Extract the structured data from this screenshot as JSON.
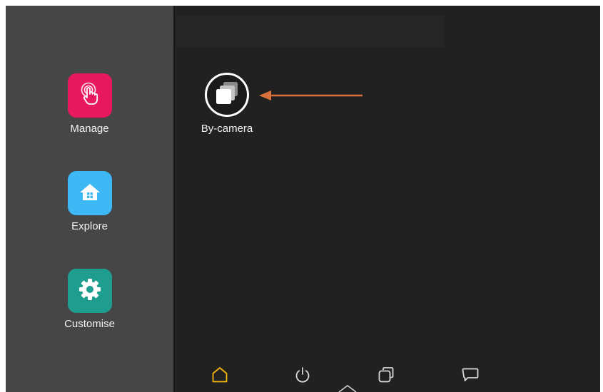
{
  "sidebar": {
    "apps": [
      {
        "label": "Manage",
        "icon": "touch-hand-icon",
        "color": "#e8185e"
      },
      {
        "label": "Explore",
        "icon": "house-icon",
        "color": "#3db8f5"
      },
      {
        "label": "Customise",
        "icon": "gear-icon",
        "color": "#1f9e8f"
      }
    ]
  },
  "home": {
    "apps": [
      {
        "label": "By-camera",
        "icon": "stacked-squares-icon"
      }
    ],
    "annotation_arrow_color": "#d9713d"
  },
  "navbar": {
    "active_color": "#f5b50a",
    "inactive_color": "#d8d8d8",
    "buttons": [
      {
        "icon": "home-icon",
        "active": true
      },
      {
        "icon": "power-icon",
        "active": false
      },
      {
        "icon": "recent-apps-icon",
        "active": false
      },
      {
        "icon": "message-icon",
        "active": false
      }
    ],
    "pull_up_icon": "chevron-up-icon"
  }
}
